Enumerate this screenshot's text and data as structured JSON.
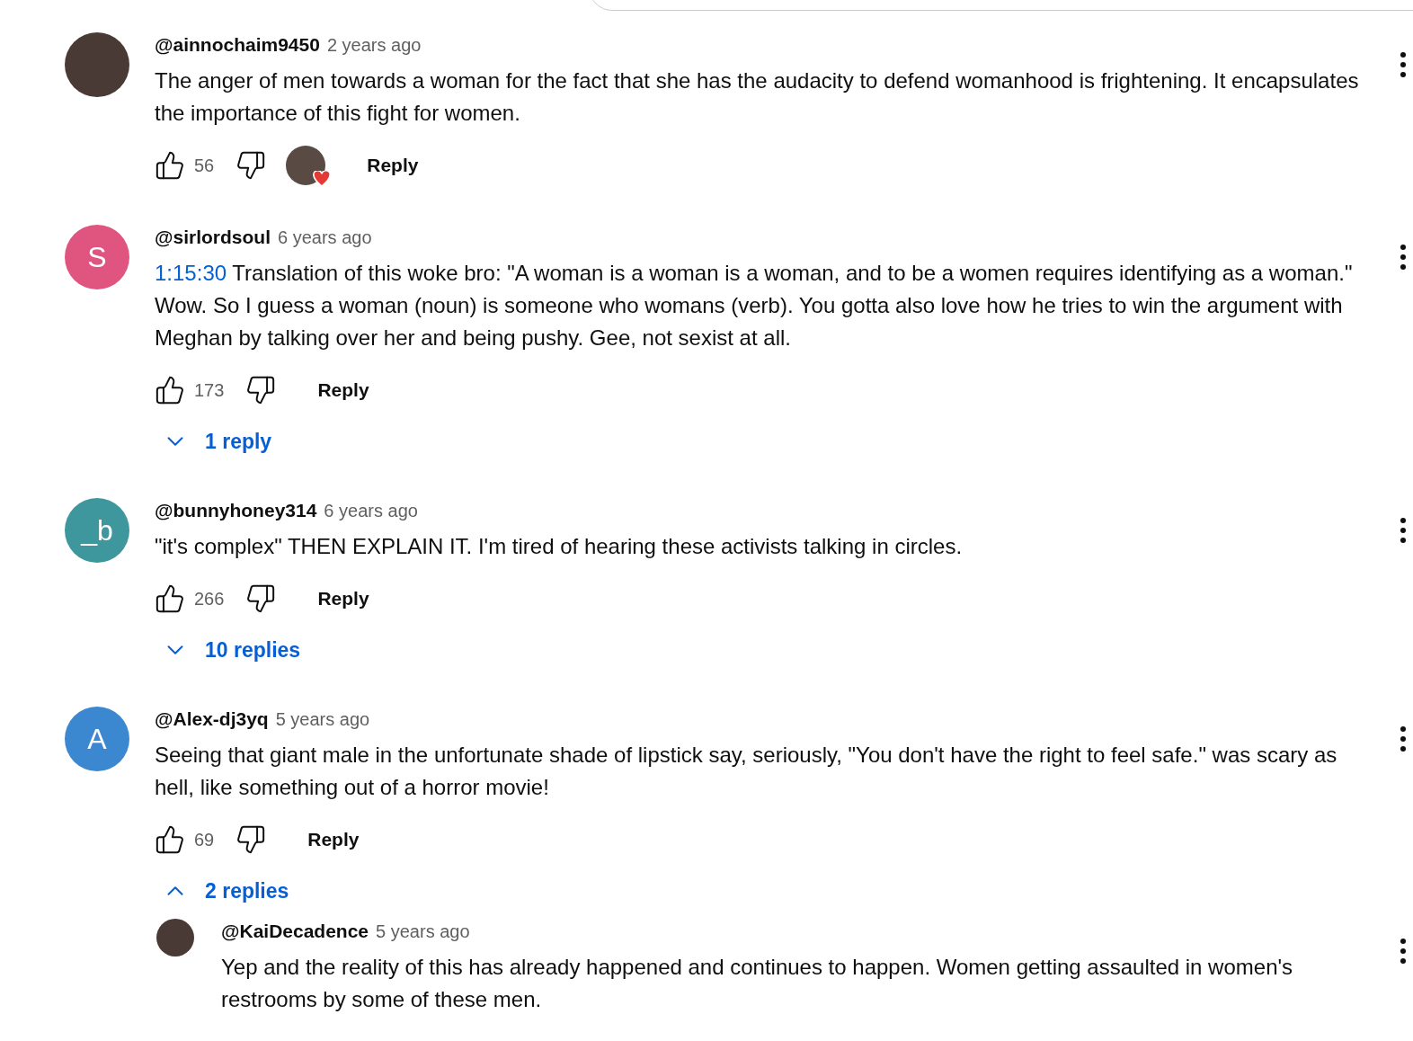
{
  "comments": [
    {
      "avatar": {
        "kind": "photo"
      },
      "author": "@ainnochaim9450",
      "time": "2 years ago",
      "text": "The anger of men towards a woman for the fact that she has the audacity to defend womanhood is frightening. It encapsulates the importance of this fight for women.",
      "likes": "56",
      "hearted": true,
      "reply_label": "Reply"
    },
    {
      "avatar": {
        "kind": "letter",
        "letter": "S",
        "color": "#e0557f"
      },
      "author": "@sirlordsoul",
      "time": "6 years ago",
      "timestamp": "1:15:30",
      "text": "Translation of this woke bro: \"A woman is a woman is a woman, and to be a women requires identifying as a woman.\" Wow. So I guess a woman (noun) is someone who womans (verb). You gotta also love how he tries to win the argument with Meghan by talking over her and being pushy. Gee, not sexist at all.",
      "likes": "173",
      "hearted": false,
      "reply_label": "Reply",
      "replies_toggle": {
        "label": "1 reply",
        "expanded": false
      }
    },
    {
      "avatar": {
        "kind": "letter",
        "letter": "_b",
        "color": "#3f979e"
      },
      "author": "@bunnyhoney314",
      "time": "6 years ago",
      "text": "\"it's complex\" THEN EXPLAIN IT. I'm tired of hearing these activists talking in circles.",
      "likes": "266",
      "hearted": false,
      "reply_label": "Reply",
      "replies_toggle": {
        "label": "10 replies",
        "expanded": false
      }
    },
    {
      "avatar": {
        "kind": "letter",
        "letter": "A",
        "color": "#3b88d0"
      },
      "author": "@Alex-dj3yq",
      "time": "5 years ago",
      "text": "Seeing that giant male in the unfortunate shade of lipstick say, seriously, \"You don't have the right to feel safe.\" was scary as hell, like something out of a horror movie!",
      "likes": "69",
      "hearted": false,
      "reply_label": "Reply",
      "replies_toggle": {
        "label": "2 replies",
        "expanded": true
      },
      "replies": [
        {
          "avatar": {
            "kind": "photo"
          },
          "author": "@KaiDecadence",
          "time": "5 years ago",
          "text": "Yep and the reality of this has already happened and continues to happen. Women getting assaulted in women's restrooms by some of  these men."
        }
      ]
    }
  ]
}
